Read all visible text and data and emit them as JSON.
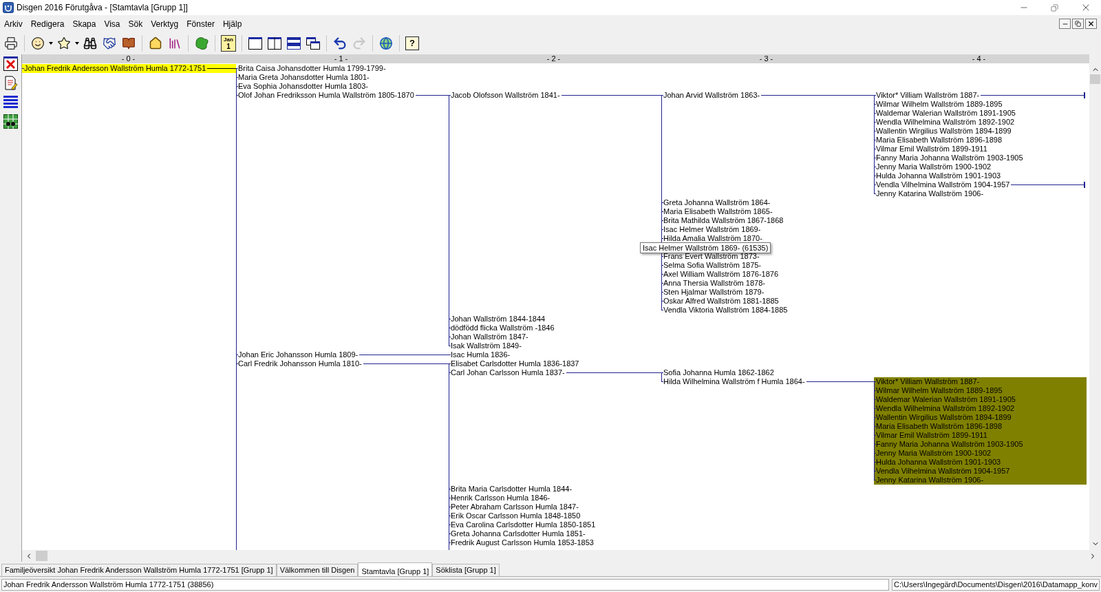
{
  "window": {
    "title": "Disgen 2016 Förutgåva - [Stamtavla [Grupp 1]]"
  },
  "menu": [
    "Arkiv",
    "Redigera",
    "Skapa",
    "Visa",
    "Sök",
    "Verktyg",
    "Fönster",
    "Hjälp"
  ],
  "toolbar": {
    "calendar_month": "Jan",
    "calendar_day": "1",
    "help_glyph": "?",
    "redo_disabled": true
  },
  "column_headers": [
    "- 0 -",
    "- 1 -",
    "- 2 -",
    "- 3 -",
    "- 4 -"
  ],
  "tree": {
    "kind": "person",
    "name": "Johan Fredrik Andersson Wallström Humla 1772-1751",
    "selected": true,
    "more_below": true,
    "children": [
      {
        "kind": "person",
        "name": "Brita Caisa Johansdotter Humla 1799-1799-",
        "selected": false
      },
      {
        "kind": "person",
        "name": "Maria Greta Johansdotter Humla 1801-",
        "selected": false
      },
      {
        "kind": "person",
        "name": "Eva Sophia Johansdotter Humla 1803-",
        "selected": false
      },
      {
        "kind": "person",
        "name": "Olof Johan Fredriksson Humla Wallström 1805-1870",
        "selected": false,
        "children": [
          {
            "kind": "person",
            "name": "Jacob Olofsson Wallström 1841-",
            "selected": false,
            "children": [
              {
                "kind": "person",
                "name": "Johan Arvid Wallström 1863-",
                "selected": false,
                "children": [
                  {
                    "kind": "person",
                    "name": "Viktor* Villiam Wallström 1887-",
                    "selected": false,
                    "more_right": true
                  },
                  {
                    "kind": "person",
                    "name": "Wilmar Wilhelm Wallström 1889-1895",
                    "selected": false
                  },
                  {
                    "kind": "person",
                    "name": "Waldemar Walerian Wallström 1891-1905",
                    "selected": false
                  },
                  {
                    "kind": "person",
                    "name": "Wendla Wilhelmina Wallström 1892-1902",
                    "selected": false
                  },
                  {
                    "kind": "person",
                    "name": "Wallentin Wirgilius Wallström 1894-1899",
                    "selected": false
                  },
                  {
                    "kind": "person",
                    "name": "Maria Elisabeth Wallström 1896-1898",
                    "selected": false
                  },
                  {
                    "kind": "person",
                    "name": "Vilmar Emil Wallström 1899-1911",
                    "selected": false
                  },
                  {
                    "kind": "person",
                    "name": "Fanny Maria Johanna Wallström 1903-1905",
                    "selected": false
                  },
                  {
                    "kind": "person",
                    "name": "Jenny Maria Wallström 1900-1902",
                    "selected": false
                  },
                  {
                    "kind": "person",
                    "name": "Hulda Johanna Wallström 1901-1903",
                    "selected": false
                  },
                  {
                    "kind": "person",
                    "name": "Vendla Vilhelmina Wallström 1904-1957",
                    "selected": false,
                    "more_right": true
                  },
                  {
                    "kind": "person",
                    "name": "Jenny Katarina Wallström 1906-",
                    "selected": false
                  }
                ]
              },
              {
                "kind": "person",
                "name": "Greta Johanna Wallström 1864-",
                "selected": false
              },
              {
                "kind": "person",
                "name": "Maria Elisabeth Wallström 1865-",
                "selected": false
              },
              {
                "kind": "person",
                "name": "Brita Mathilda Wallström 1867-1868",
                "selected": false
              },
              {
                "kind": "person",
                "name": "Isac Helmer Wallström 1869-",
                "selected": false
              },
              {
                "kind": "person",
                "name": "Hilda Amalia Wallström 1870-",
                "selected": false
              },
              {
                "kind": "tooltip",
                "text": "Isac Helmer Wallström 1869- (61535)"
              },
              {
                "kind": "person",
                "name": "Frans Evert Wallström 1873-",
                "selected": false
              },
              {
                "kind": "person",
                "name": "Selma Sofia Wallström 1875-",
                "selected": false
              },
              {
                "kind": "person",
                "name": "Axel William Wallström 1876-1876",
                "selected": false
              },
              {
                "kind": "person",
                "name": "Anna Thersia Wallström 1878-",
                "selected": false
              },
              {
                "kind": "person",
                "name": "Sten Hjalmar Wallström 1879-",
                "selected": false
              },
              {
                "kind": "person",
                "name": "Oskar Alfred Wallström 1881-1885",
                "selected": false
              },
              {
                "kind": "person",
                "name": "Vendla Viktoria Wallström 1884-1885",
                "selected": false
              }
            ]
          },
          {
            "kind": "person",
            "name": "Johan Wallström 1844-1844",
            "selected": false
          },
          {
            "kind": "person",
            "name": "dödfödd flicka Wallström -1846",
            "selected": false
          },
          {
            "kind": "person",
            "name": "Johan Wallström 1847-",
            "selected": false
          },
          {
            "kind": "person",
            "name": "Isak Wallström 1849-",
            "selected": false
          }
        ]
      },
      {
        "kind": "person",
        "name": "Johan Eric Johansson Humla 1809-",
        "selected": false,
        "children": [
          {
            "kind": "person",
            "name": "Isac Humla 1836-",
            "selected": false
          }
        ]
      },
      {
        "kind": "person",
        "name": "Carl Fredrik Johansson Humla 1810-",
        "selected": false,
        "more_below": true,
        "children": [
          {
            "kind": "person",
            "name": "Elisabet Carlsdotter Humla 1836-1837",
            "selected": false
          },
          {
            "kind": "person",
            "name": "Carl Johan Carlsson Humla 1837-",
            "selected": false,
            "children": [
              {
                "kind": "person",
                "name": "Sofia Johanna Humla 1862-1862",
                "selected": false
              },
              {
                "kind": "person",
                "name": "Hilda Wilhelmina Wallström f Humla 1864-",
                "selected": false,
                "children_highlighted": true,
                "children": [
                  {
                    "kind": "person",
                    "name": "Viktor* Villiam Wallström 1887-",
                    "selected": false
                  },
                  {
                    "kind": "person",
                    "name": "Wilmar Wilhelm Wallström 1889-1895",
                    "selected": false
                  },
                  {
                    "kind": "person",
                    "name": "Waldemar Walerian Wallström 1891-1905",
                    "selected": false
                  },
                  {
                    "kind": "person",
                    "name": "Wendla Wilhelmina Wallström 1892-1902",
                    "selected": false
                  },
                  {
                    "kind": "person",
                    "name": "Wallentin Wirgilius Wallström 1894-1899",
                    "selected": false
                  },
                  {
                    "kind": "person",
                    "name": "Maria Elisabeth Wallström 1896-1898",
                    "selected": false
                  },
                  {
                    "kind": "person",
                    "name": "Vilmar Emil Wallström 1899-1911",
                    "selected": false
                  },
                  {
                    "kind": "person",
                    "name": "Fanny Maria Johanna Wallström 1903-1905",
                    "selected": false
                  },
                  {
                    "kind": "person",
                    "name": "Jenny Maria Wallström 1900-1902",
                    "selected": false
                  },
                  {
                    "kind": "person",
                    "name": "Hulda Johanna Wallström 1901-1903",
                    "selected": false
                  },
                  {
                    "kind": "person",
                    "name": "Vendla Vilhelmina Wallström 1904-1957",
                    "selected": false
                  },
                  {
                    "kind": "person",
                    "name": "Jenny Katarina Wallström 1906-",
                    "selected": false
                  }
                ]
              }
            ]
          },
          {
            "kind": "person",
            "name": "Brita Maria Carlsdotter Humla 1844-",
            "selected": false
          },
          {
            "kind": "person",
            "name": "Henrik Carlsson Humla 1846-",
            "selected": false
          },
          {
            "kind": "person",
            "name": "Peter Abraham Carlsson Humla 1847-",
            "selected": false
          },
          {
            "kind": "person",
            "name": "Erik Oscar Carlsson Humla 1848-1850",
            "selected": false
          },
          {
            "kind": "person",
            "name": "Eva Carolina Carlsdotter Humla 1850-1851",
            "selected": false
          },
          {
            "kind": "person",
            "name": "Greta Johanna Carlsdotter Humla 1851-",
            "selected": false
          },
          {
            "kind": "person",
            "name": "Fredrik August Carlsson Humla 1853-1853",
            "selected": false
          }
        ]
      }
    ]
  },
  "tabs": [
    {
      "label": "Familjeöversikt Johan Fredrik Andersson Wallström Humla 1772-1751 [Grupp 1]",
      "selected": false
    },
    {
      "label": "Välkommen till Disgen",
      "selected": false
    },
    {
      "label": "Stamtavla [Grupp 1]",
      "selected": true
    },
    {
      "label": "Söklista [Grupp 1]",
      "selected": false
    }
  ],
  "status_bar": {
    "person": "Johan Fredrik Andersson Wallström Humla 1772-1751 (38856)",
    "path": "C:\\Users\\Ingegärd\\Documents\\Disgen\\2016\\Datamapp_konv"
  }
}
